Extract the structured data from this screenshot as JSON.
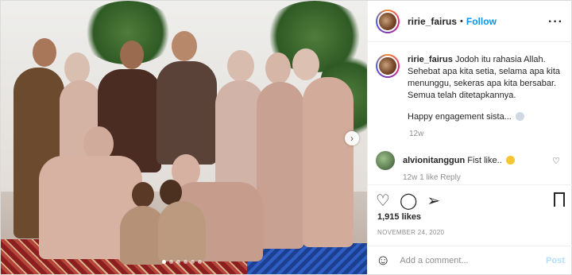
{
  "header": {
    "username": "ririe_fairus",
    "separator": "•",
    "follow_label": "Follow",
    "more_icon": "more-horizontal-icon"
  },
  "caption": {
    "username": "ririe_fairus",
    "text": "Jodoh itu rahasia Allah. Sehebat apa kita setia, selama apa kita menunggu, sekeras apa kita bersabar. Semua telah ditetapkannya.",
    "extra": "Happy engagement sista...",
    "time": "12w"
  },
  "comments": [
    {
      "username": "alvionitanggun",
      "text": "Fist like..",
      "meta": "12w   1 like   Reply"
    }
  ],
  "actions": {
    "like_icon": "heart-icon",
    "comment_icon": "comment-icon",
    "share_icon": "send-icon",
    "save_icon": "bookmark-icon"
  },
  "likes": "1,915 likes",
  "date": "NOVEMBER 24, 2020",
  "add_comment": {
    "placeholder": "Add a comment...",
    "post_label": "Post",
    "emoji_icon": "smiley-icon"
  },
  "carousel": {
    "slides": 6,
    "active_index": 0,
    "next_icon": "chevron-right-icon"
  },
  "colors": {
    "link": "#0095f6",
    "text": "#262626",
    "muted": "#8e8e8e",
    "post_disabled": "#b2dffc"
  }
}
